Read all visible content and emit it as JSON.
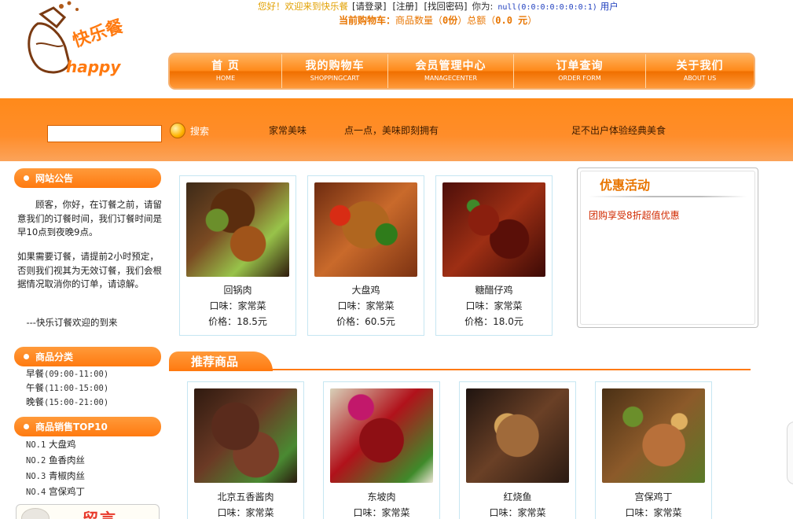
{
  "brand": {
    "logo_text": "happy",
    "logo_zh": "快乐餐"
  },
  "topbar": {
    "welcome": "您好！欢迎来到快乐餐",
    "login": "[请登录]",
    "register": "[注册]",
    "forgot": "[找回密码]",
    "you_are": "你为:",
    "ip": "null(0:0:0:0:0:0:0:1)",
    "user": "用户"
  },
  "cart": {
    "label": "当前购物车：",
    "qty_label": "商品数量（",
    "qty": "0份",
    "total_label": "）总额（",
    "total": "0.0 元",
    "close": "）"
  },
  "nav": [
    {
      "zh": "首 页",
      "en": "HOME"
    },
    {
      "zh": "我的购物车",
      "en": "SHOPPINGCART"
    },
    {
      "zh": "会员管理中心",
      "en": "MANAGECENTER"
    },
    {
      "zh": "订单查询",
      "en": "ORDER FORM"
    },
    {
      "zh": "关于我们",
      "en": "ABOUT US"
    }
  ],
  "search": {
    "button": "搜索",
    "placeholder": ""
  },
  "band": {
    "tag1": "家常美味",
    "tag2": "点一点，美味即刻拥有",
    "tag3": "足不出户体验经典美食"
  },
  "notice": {
    "title": "网站公告",
    "p1": "　　顾客，你好，在订餐之前，请留意我们的订餐时间，我们订餐时间是早10点到夜晚9点。",
    "p2": "如果需要订餐，请提前2小时预定，否则我们视其为无效订餐，我们会根据情况取消你的订单，请谅解。",
    "p3": "　---快乐订餐欢迎的到来"
  },
  "categories": {
    "title": "商品分类",
    "items": [
      {
        "name": "早餐",
        "time": "(09:00-11:00)"
      },
      {
        "name": "午餐",
        "time": "(11:00-15:00)"
      },
      {
        "name": "晚餐",
        "time": "(15:00-21:00)"
      }
    ]
  },
  "top10": {
    "title": "商品销售TOP10",
    "items": [
      {
        "no": "NO.1",
        "name": "大盘鸡"
      },
      {
        "no": "NO.2",
        "name": "鱼香肉丝"
      },
      {
        "no": "NO.3",
        "name": "青椒肉丝"
      },
      {
        "no": "NO.4",
        "name": "宫保鸡丁"
      }
    ]
  },
  "guestbook": {
    "label": "留言"
  },
  "featured": [
    {
      "name": "回锅肉",
      "taste": "口味：家常菜",
      "price": "价格：18.5元"
    },
    {
      "name": "大盘鸡",
      "taste": "口味：家常菜",
      "price": "价格：60.5元"
    },
    {
      "name": "糖醋仔鸡",
      "taste": "口味：家常菜",
      "price": "价格：18.0元"
    }
  ],
  "promo": {
    "title": "优惠活动",
    "deal": "团购享受8折超值优惠"
  },
  "recommend": {
    "title": "推荐商品",
    "items": [
      {
        "name": "北京五香酱肉",
        "taste": "口味：家常菜"
      },
      {
        "name": "东坡肉",
        "taste": "口味：家常菜"
      },
      {
        "name": "红烧鱼",
        "taste": "口味：家常菜"
      },
      {
        "name": "宫保鸡丁",
        "taste": "口味：家常菜"
      }
    ]
  },
  "colors": {
    "accent": "#ff7a10",
    "link_blue": "#1f3fbf",
    "promo_red": "#d12a00"
  }
}
